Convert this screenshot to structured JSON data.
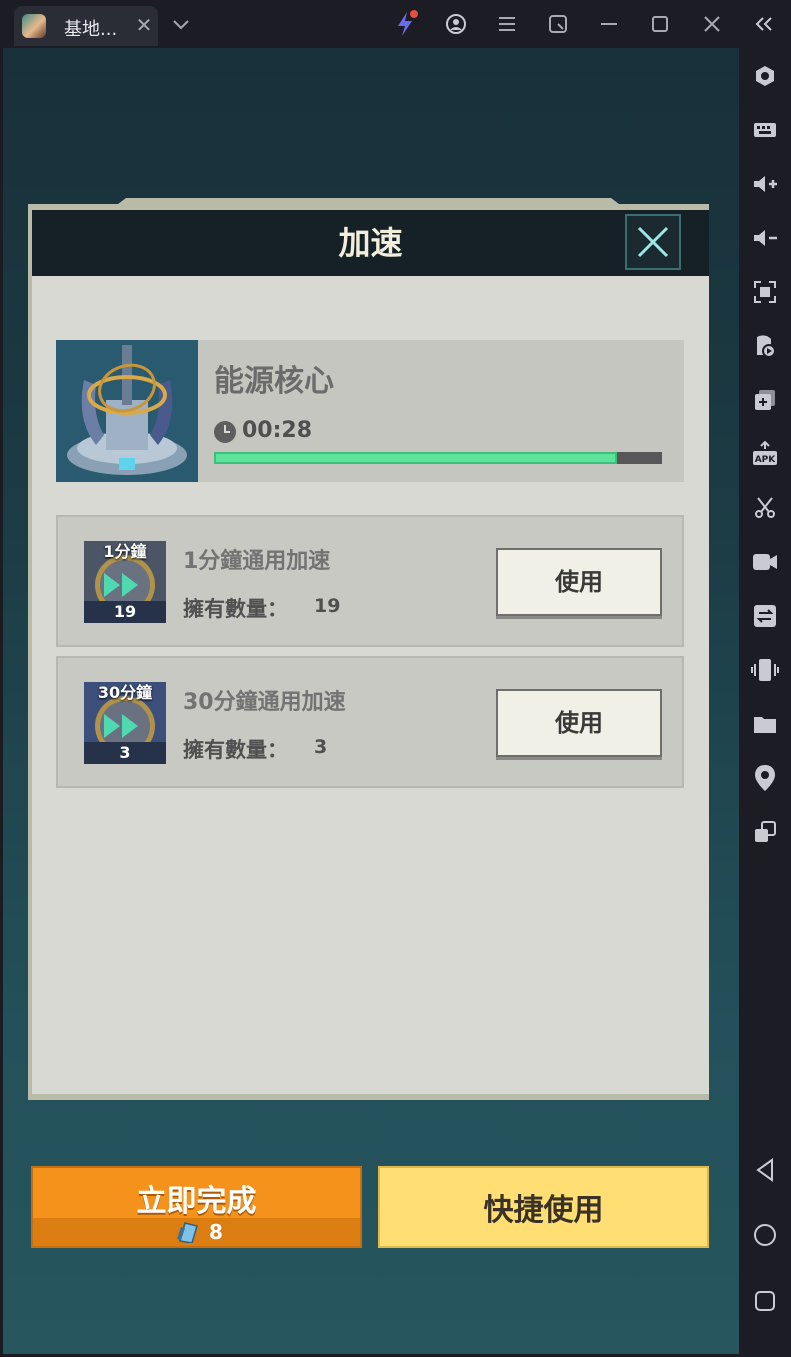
{
  "titlebar": {
    "tab_title": "基地...",
    "tab_close_glyph": "✕",
    "icons": [
      "tab-avatar-icon",
      "chevron-down-icon",
      "lightning-icon",
      "account-icon",
      "menu-icon",
      "screenshot-icon",
      "minimize-icon",
      "maximize-icon",
      "close-icon",
      "collapse-sidebar-icon"
    ]
  },
  "sidebar": {
    "icons": [
      "settings-hex-icon",
      "keyboard-icon",
      "volume-up-icon",
      "volume-down-icon",
      "fullscreen-icon",
      "gamepad-icon",
      "multi-instance-icon",
      "apk-install-icon",
      "scissors-icon",
      "record-icon",
      "sync-icon",
      "shake-icon",
      "folder-icon",
      "location-icon",
      "rotate-icon",
      "back-icon",
      "home-icon",
      "recents-icon"
    ]
  },
  "dialog": {
    "title": "加速",
    "target": {
      "name": "能源核心",
      "timer": "00:28",
      "progress": 0.9
    },
    "items": [
      {
        "icon_label": "1分鐘",
        "icon_count": "19",
        "name": "1分鐘通用加速",
        "owned_label": "擁有數量：",
        "owned_value": "19",
        "button": "使用"
      },
      {
        "icon_label": "30分鐘",
        "icon_count": "3",
        "name": "30分鐘通用加速",
        "owned_label": "擁有數量：",
        "owned_value": "3",
        "button": "使用"
      }
    ]
  },
  "actions": {
    "complete_label": "立即完成",
    "complete_cost": "8",
    "quick_use_label": "快捷使用"
  },
  "colors": {
    "progress_fill": "#5de39a",
    "complete_button": "#f4921b",
    "quick_button": "#ffde73",
    "notification_dot": "#e74c3c",
    "accent_lightning": "#6a6cf0"
  }
}
